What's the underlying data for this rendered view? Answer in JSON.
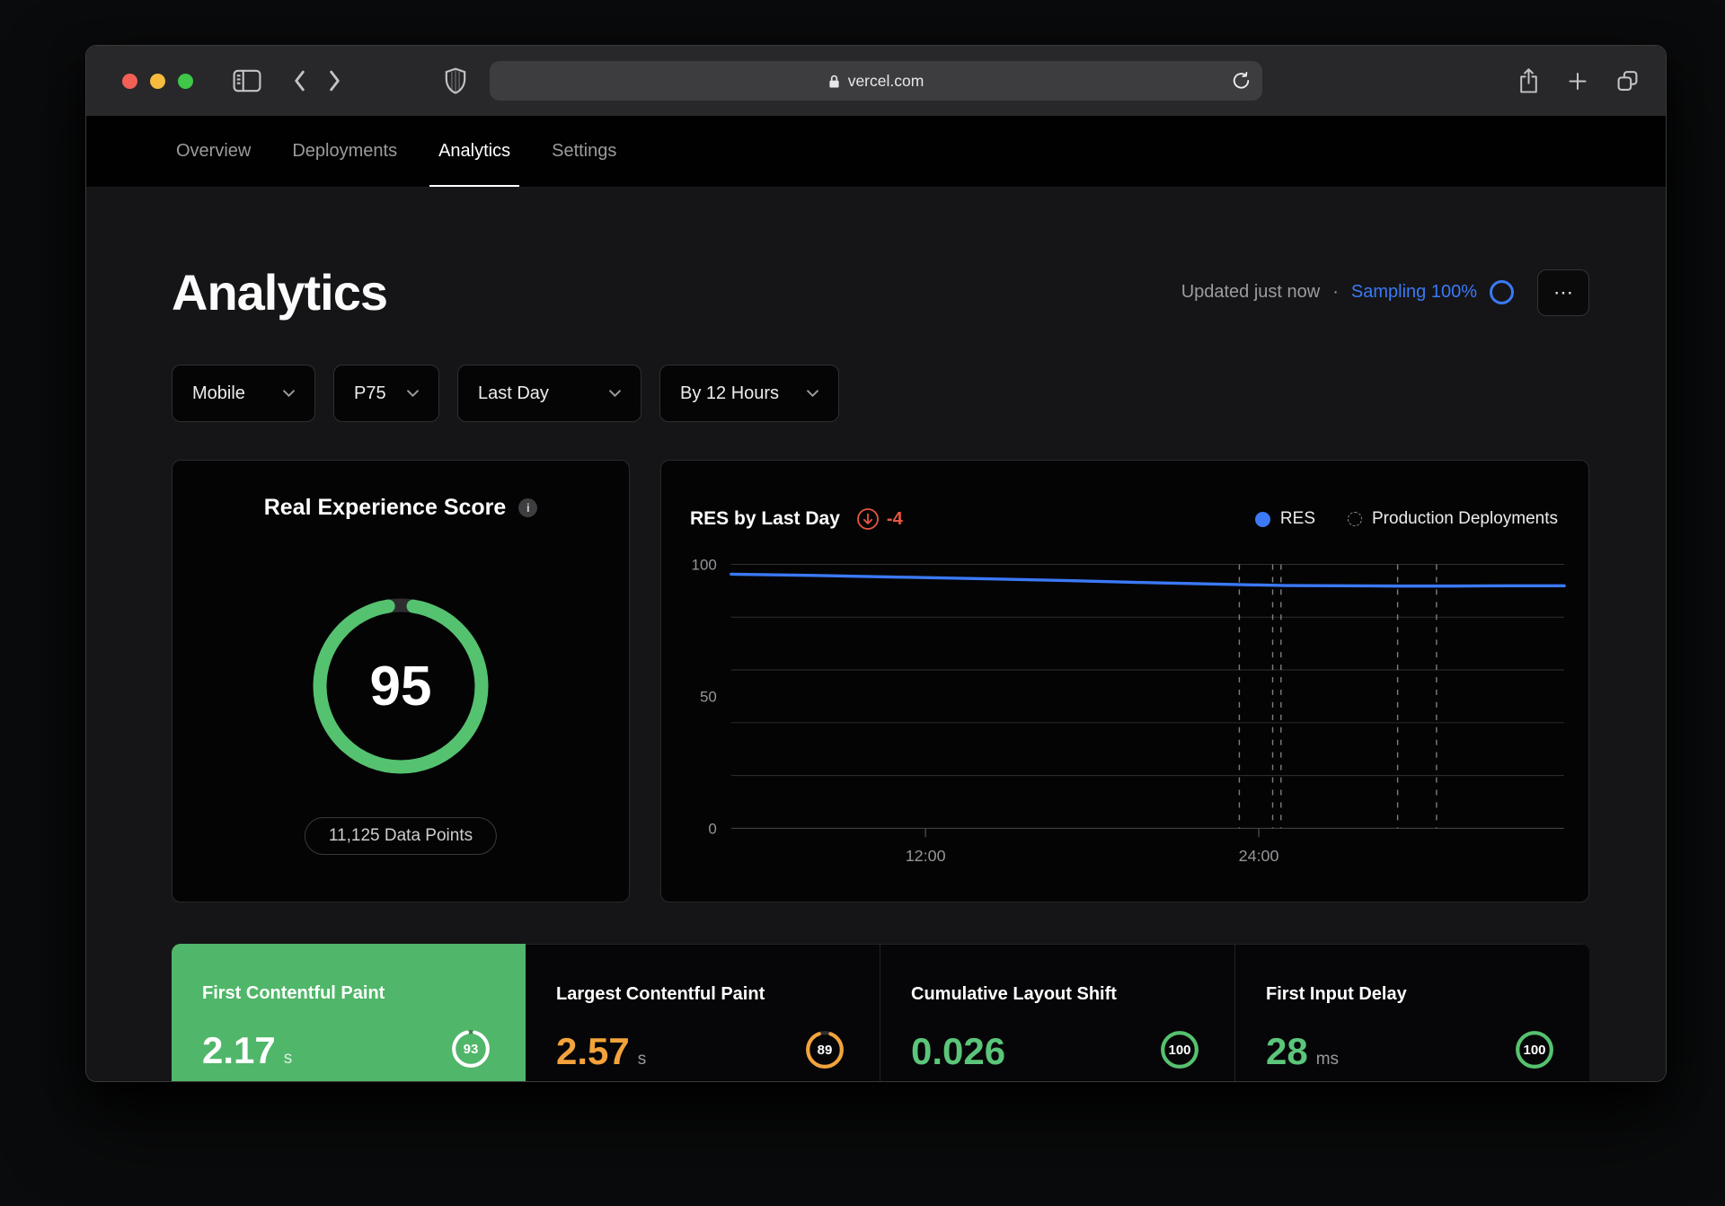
{
  "browser": {
    "url": "vercel.com",
    "traffic_light_colors": [
      "#f15f57",
      "#f6bc3e",
      "#3ec748"
    ]
  },
  "nav": {
    "tabs": [
      {
        "label": "Overview",
        "active": false
      },
      {
        "label": "Deployments",
        "active": false
      },
      {
        "label": "Analytics",
        "active": true
      },
      {
        "label": "Settings",
        "active": false
      }
    ]
  },
  "header": {
    "title": "Analytics",
    "updated": "Updated just now",
    "separator": "·",
    "sampling_label": "Sampling 100%",
    "menu_icon": "⋯"
  },
  "filters": [
    {
      "label": "Mobile"
    },
    {
      "label": "P75"
    },
    {
      "label": "Last Day"
    },
    {
      "label": "By 12 Hours"
    }
  ],
  "score_card": {
    "title": "Real Experience Score",
    "info_icon": "i",
    "score": "95",
    "data_points_label": "11,125 Data Points",
    "ring_color": "#55c26f",
    "track_color": "#2e2e31"
  },
  "chart_card": {
    "title": "RES by Last Day",
    "delta_label": "-4",
    "legend": [
      {
        "label": "RES",
        "marker": "filled-dot",
        "color": "#3b79f6"
      },
      {
        "label": "Production Deployments",
        "marker": "dashed-circle"
      }
    ]
  },
  "chart_data": {
    "type": "line",
    "title": "RES by Last Day",
    "delta": -4,
    "x_unit": "hours",
    "x_domain": [
      5,
      35
    ],
    "x_ticks": [
      {
        "hour": 12,
        "label": "12:00"
      },
      {
        "hour": 24,
        "label": "24:00"
      }
    ],
    "ylim": [
      0,
      100
    ],
    "y_tick_labels": [
      {
        "value": 100,
        "label": "100"
      },
      {
        "value": 50,
        "label": "50"
      },
      {
        "value": 0,
        "label": "0"
      }
    ],
    "gridline_step": 20,
    "grid": true,
    "legend_position": "top-right",
    "series": [
      {
        "name": "RES",
        "color": "#3b79f6",
        "x": [
          5,
          8,
          11,
          14,
          17,
          20,
          23,
          25,
          27,
          29,
          31,
          33,
          35
        ],
        "y": [
          96.3,
          95.8,
          95.2,
          94.6,
          93.9,
          93.1,
          92.4,
          92.0,
          91.9,
          91.8,
          91.8,
          91.9,
          91.9
        ]
      }
    ],
    "deployment_markers_hours": [
      23.3,
      24.5,
      24.8,
      29.0,
      30.4
    ]
  },
  "metrics": [
    {
      "title": "First Contentful Paint",
      "value": "2.17",
      "unit": "s",
      "score": "93",
      "card_bg": "#50b669",
      "value_color": "#ffffff",
      "unit_color": "#ddf0e3",
      "ring_color": "#ffffff",
      "ring_track": "rgba(0,0,0,0.28)",
      "selected": true
    },
    {
      "title": "Largest Contentful Paint",
      "value": "2.57",
      "unit": "s",
      "score": "89",
      "card_bg": "",
      "value_color": "#f3a33b",
      "unit_color": "#9a9a9d",
      "ring_color": "#f3a33b",
      "ring_track": "#2f2f32",
      "selected": false
    },
    {
      "title": "Cumulative Layout Shift",
      "value": "0.026",
      "unit": "",
      "score": "100",
      "card_bg": "",
      "value_color": "#5bc57a",
      "unit_color": "#9a9a9d",
      "ring_color": "#55c26f",
      "ring_track": "#2f2f32",
      "selected": false
    },
    {
      "title": "First Input Delay",
      "value": "28",
      "unit": "ms",
      "score": "100",
      "card_bg": "",
      "value_color": "#5bc57a",
      "unit_color": "#9a9a9d",
      "ring_color": "#55c26f",
      "ring_track": "#2f2f32",
      "selected": false
    }
  ],
  "colors": {
    "accent_blue": "#3b79f6",
    "success_green": "#55c26f",
    "warning_orange": "#f3a33b",
    "danger_red": "#e8563f"
  }
}
